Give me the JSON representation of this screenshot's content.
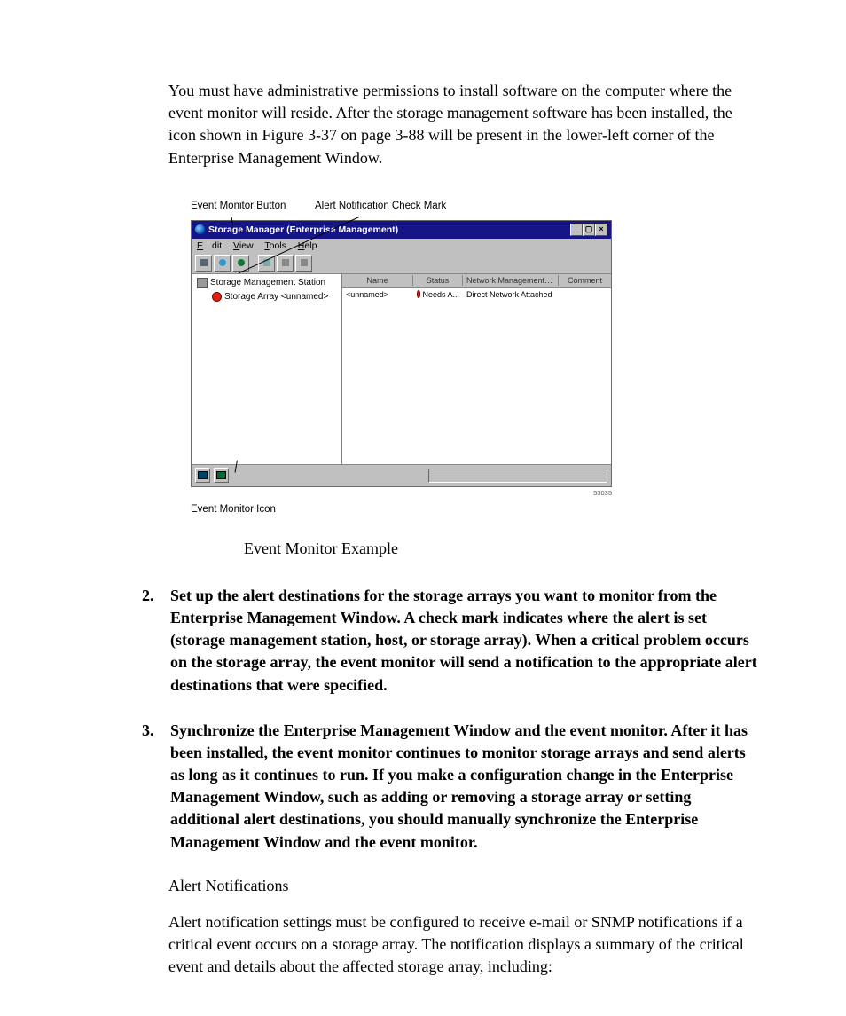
{
  "intro": "You must have administrative permissions to install software on the computer where the event monitor will reside. After the storage management software has been installed, the icon shown in Figure 3-37 on page 3-88 will be present in the lower-left corner of the Enterprise Management Window.",
  "callouts": {
    "top_left": "Event Monitor Button",
    "top_right": "Alert Notification Check Mark",
    "bottom": "Event Monitor Icon"
  },
  "window": {
    "title": "Storage Manager  (Enterprise Management)",
    "menu": {
      "edit": "Edit",
      "view": "View",
      "tools": "Tools",
      "help": "Help"
    },
    "tree": {
      "root": "Storage Management Station",
      "child": "Storage Array <unnamed>"
    },
    "columns": {
      "name": "Name",
      "status": "Status",
      "nmt": "Network Management Type",
      "comment": "Comment"
    },
    "row": {
      "name": "<unnamed>",
      "status": "Needs A...",
      "nmt": "Direct Network Attached",
      "comment": ""
    },
    "tinytag": "53035"
  },
  "figure_caption": "Event Monitor Example",
  "items": {
    "n2": "2.",
    "b2": "Set up the alert destinations for the storage arrays you want to monitor from the Enterprise Management Window. A check mark indicates where the alert is set (storage management station, host, or storage array). When a critical problem occurs on the storage array, the event monitor will send a notification to the appropriate alert destinations that were specified.",
    "n3": "3.",
    "b3": "Synchronize the Enterprise Management Window and the event monitor. After it has been installed, the event monitor continues to monitor storage arrays and send alerts as long as it continues to run. If you make a configuration change in the Enterprise Management Window, such as adding or removing a storage array or setting additional alert destinations, you should manually synchronize the Enterprise Management Window and the event monitor."
  },
  "subhead": "Alert Notifications",
  "para2": "Alert notification settings must be configured to receive e-mail or SNMP notifications if a critical event occurs on a storage array. The notification displays a summary of the critical event and details about the affected storage array, including:"
}
